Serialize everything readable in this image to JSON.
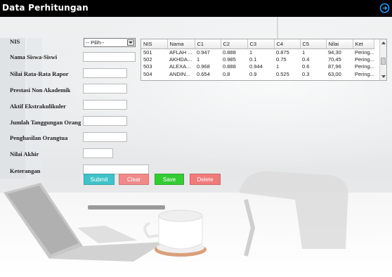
{
  "window": {
    "title": "Data Perhitungan"
  },
  "form": {
    "labels": {
      "nis": "NIS",
      "nama": "Nama Siswa-Siswi",
      "nilai_rapor": "Nilai Rata-Rata Rapor",
      "prestasi": "Prestasi Non Akademik",
      "ekskul": "Aktif Ekstrakulikuler",
      "tanggungan": "Jumlah Tanggungan Orang",
      "penghasilan": "Penghasilan Orangtua",
      "nilai_akhir": "Nilai Akhir",
      "keterangan": "Keterangan"
    },
    "nis_select": "-- Pilih--",
    "values": {
      "nama": "",
      "nilai_rapor": "",
      "prestasi": "",
      "ekskul": "",
      "tanggungan": "",
      "penghasilan": "",
      "nilai_akhir": "",
      "keterangan": ""
    }
  },
  "buttons": {
    "submit": {
      "label": "Submit",
      "color": "#3fc2c9"
    },
    "clear": {
      "label": "Clear",
      "color": "#f08a8a"
    },
    "save": {
      "label": "Save",
      "color": "#33cc33"
    },
    "delete": {
      "label": "Delete",
      "color": "#f07a7a"
    }
  },
  "table": {
    "columns": [
      "NIS",
      "Nama",
      "C1",
      "C2",
      "C3",
      "C4",
      "C5",
      "Nilai",
      "Ket"
    ],
    "rows": [
      [
        "501",
        "AFLAH ...",
        "0.947",
        "0.888",
        "1",
        "0.875",
        "1",
        "94,30",
        "Pering..."
      ],
      [
        "502",
        "AKHDA...",
        "1",
        "0.985",
        "0.1",
        "0.75",
        "0.4",
        "70,45",
        "Pering..."
      ],
      [
        "503",
        "ALEXA...",
        "0.968",
        "0.888",
        "0.944",
        "1",
        "0.6",
        "87,96",
        "Pering..."
      ],
      [
        "504",
        "ANDIN...",
        "0.654",
        "0.8",
        "0.9",
        "0.525",
        "0.3",
        "63,00",
        "Pering..."
      ]
    ]
  },
  "icons": {
    "exit": "exit-icon",
    "dropdown": "chevron-down-icon"
  }
}
